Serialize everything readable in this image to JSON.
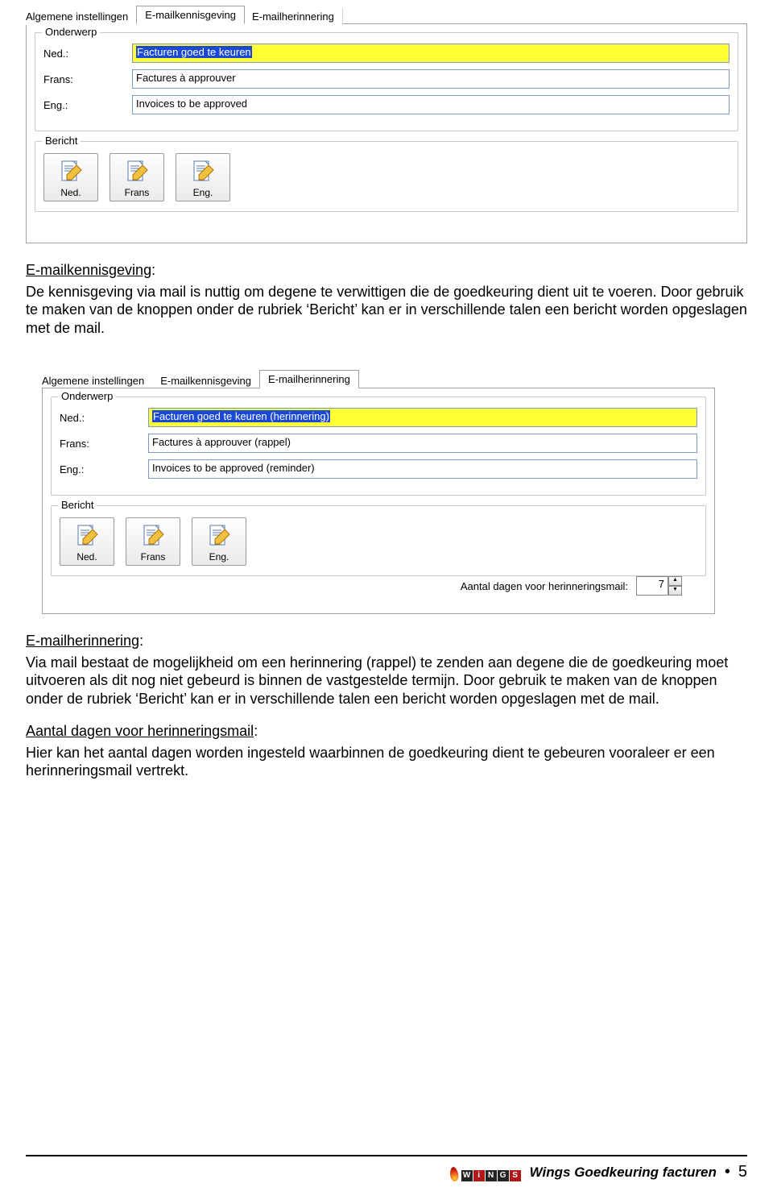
{
  "shot1": {
    "tabs": [
      "Algemene instellingen",
      "E-mailkennisgeving",
      "E-mailherinnering"
    ],
    "active_tab": 1,
    "onderwerp": {
      "title": "Onderwerp",
      "rows": [
        {
          "label": "Ned.:",
          "value": "Facturen goed te keuren",
          "highlight": true
        },
        {
          "label": "Frans:",
          "value": "Factures à approuver",
          "highlight": false
        },
        {
          "label": "Eng.:",
          "value": "Invoices to be approved",
          "highlight": false
        }
      ]
    },
    "bericht": {
      "title": "Bericht",
      "buttons": [
        "Ned.",
        "Frans",
        "Eng."
      ]
    }
  },
  "text1": {
    "h": "E-mailkennisgeving",
    "body": "De kennisgeving via mail is nuttig om degene te verwittigen die de goedkeuring dient uit te voeren.  Door gebruik te maken van de knoppen onder de rubriek ‘Bericht’ kan er in verschillende talen een bericht worden opgeslagen met de mail."
  },
  "shot2": {
    "tabs": [
      "Algemene instellingen",
      "E-mailkennisgeving",
      "E-mailherinnering"
    ],
    "active_tab": 2,
    "onderwerp": {
      "title": "Onderwerp",
      "rows": [
        {
          "label": "Ned.:",
          "value": "Facturen goed te keuren (herinnering)",
          "highlight": true
        },
        {
          "label": "Frans:",
          "value": "Factures à approuver (rappel)",
          "highlight": false
        },
        {
          "label": "Eng.:",
          "value": "Invoices to be approved (reminder)",
          "highlight": false
        }
      ]
    },
    "bericht": {
      "title": "Bericht",
      "buttons": [
        "Ned.",
        "Frans",
        "Eng."
      ]
    },
    "counter": {
      "label": "Aantal dagen voor herinneringsmail:",
      "value": "7"
    }
  },
  "text2": {
    "h": "E-mailherinnering",
    "body": "Via mail bestaat de mogelijkheid om een herinnering (rappel) te zenden aan degene die de goedkeuring moet uitvoeren als dit nog niet gebeurd is binnen de vastgestelde termijn.  Door gebruik te maken van de knoppen onder de rubriek ‘Bericht’ kan er in verschillende talen een bericht worden opgeslagen met de mail."
  },
  "text3": {
    "h": "Aantal dagen voor herinneringsmail",
    "body": "Hier kan het aantal dagen worden ingesteld waarbinnen de goedkeuring dient te gebeuren vooraleer er een herinneringsmail vertrekt."
  },
  "footer": {
    "title": "Wings Goedkeuring facturen",
    "page": "5",
    "logo": "WiNGS"
  }
}
